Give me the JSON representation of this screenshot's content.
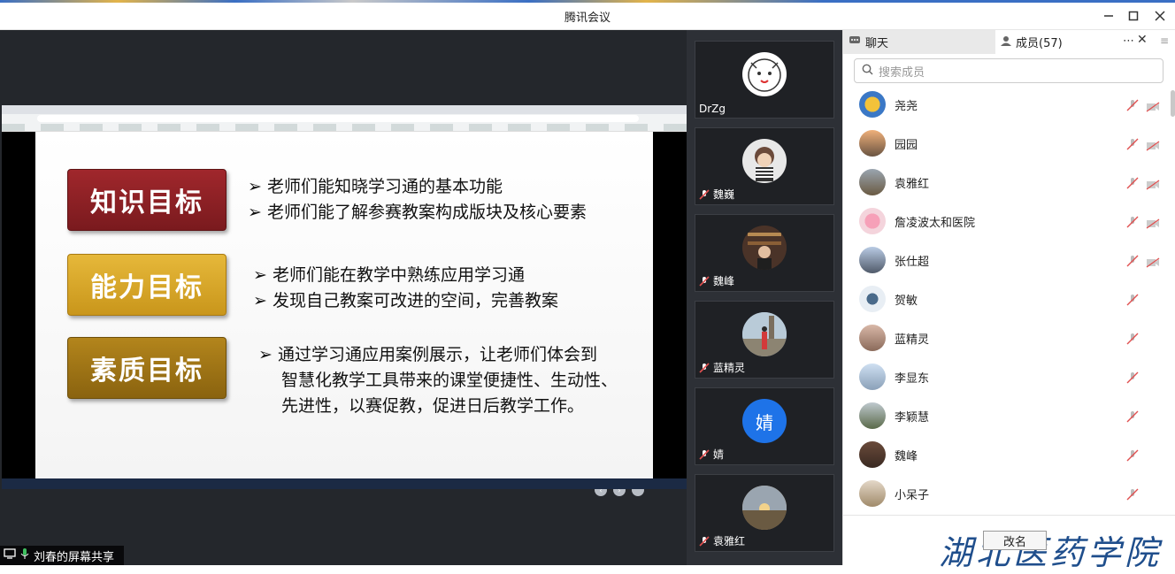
{
  "window": {
    "title": "腾讯会议",
    "controls": [
      "minimize-icon",
      "maximize-icon",
      "close-icon"
    ]
  },
  "slide": {
    "goals": [
      {
        "label": "知识目标",
        "color": "#8e2025"
      },
      {
        "label": "能力目标",
        "color": "#d9a829"
      },
      {
        "label": "素质目标",
        "color": "#9d7415"
      }
    ],
    "bullets": [
      "➢ 老师们能知晓学习通的基本功能",
      "➢ 老师们能了解参赛教案构成版块及核心要素",
      "➢ 老师们能在教学中熟练应用学习通",
      "➢ 发现自己教案可改进的空间，完善教案",
      "➢ 通过学习通应用案例展示，让老师们体会到",
      "智慧化教学工具带来的课堂便捷性、生动性、",
      "先进性，以赛促教，促进日后教学工作。"
    ]
  },
  "share": {
    "label": "刘春的屏幕共享"
  },
  "tiles": [
    {
      "name": "DrZg",
      "muted": false,
      "initial": ""
    },
    {
      "name": "魏巍",
      "muted": true,
      "initial": ""
    },
    {
      "name": "魏峰",
      "muted": true,
      "initial": ""
    },
    {
      "name": "蓝精灵",
      "muted": true,
      "initial": ""
    },
    {
      "name": "婧",
      "muted": true,
      "initial": "婧"
    },
    {
      "name": "袁雅红",
      "muted": true,
      "initial": ""
    }
  ],
  "panel": {
    "chat_tab": "聊天",
    "members_tab": "成员(57)",
    "search_placeholder": "搜索成员",
    "rename_button": "改名",
    "watermark": "湖北医药学院",
    "members": [
      {
        "name": "尧尧",
        "camera_off": true
      },
      {
        "name": "园园",
        "camera_off": true
      },
      {
        "name": "袁雅红",
        "camera_off": true
      },
      {
        "name": "詹凌波太和医院",
        "camera_off": true
      },
      {
        "name": "张仕超",
        "camera_off": true
      },
      {
        "name": "贺敏",
        "camera_off": false
      },
      {
        "name": "蓝精灵",
        "camera_off": false
      },
      {
        "name": "李显东",
        "camera_off": false
      },
      {
        "name": "李颖慧",
        "camera_off": false
      },
      {
        "name": "魏峰",
        "camera_off": false
      },
      {
        "name": "小呆子",
        "camera_off": false
      }
    ]
  },
  "colors": {
    "accent": "#1e73e8",
    "mic_muted": "#e05050"
  }
}
